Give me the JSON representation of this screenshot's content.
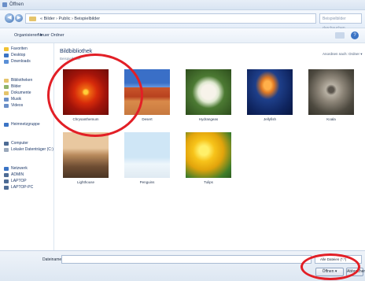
{
  "window": {
    "title": "Öffnen"
  },
  "address": {
    "path": "« Bilder › Public › Beispielbilder",
    "search_placeholder": "Beispielbilder durchsuchen"
  },
  "toolbar": {
    "organize": "Organisieren ▾",
    "new_folder": "Neuer Ordner"
  },
  "sidebar": {
    "items": [
      {
        "label": "Favoriten",
        "icon": "star-icon"
      },
      {
        "label": "Desktop",
        "icon": "desktop-icon"
      },
      {
        "label": "Downloads",
        "icon": "download-icon"
      },
      {
        "label": "Bibliotheken",
        "icon": "library-icon"
      },
      {
        "label": "Bilder",
        "icon": "pictures-icon"
      },
      {
        "label": "Dokumente",
        "icon": "documents-icon"
      },
      {
        "label": "Musik",
        "icon": "music-icon"
      },
      {
        "label": "Videos",
        "icon": "videos-icon"
      },
      {
        "label": "Heimnetzgruppe",
        "icon": "homegroup-icon"
      },
      {
        "label": "Computer",
        "icon": "computer-icon"
      },
      {
        "label": "Lokaler Datenträger (C:)",
        "icon": "drive-icon"
      },
      {
        "label": "Netzwerk",
        "icon": "network-icon"
      },
      {
        "label": "ADMIN",
        "icon": "network-pc-icon"
      },
      {
        "label": "LAPTOP",
        "icon": "network-pc-icon"
      },
      {
        "label": "LAPTOP-PC",
        "icon": "network-pc-icon"
      }
    ]
  },
  "content": {
    "title": "Bildbibliothek",
    "subtitle": "Beispielbilder",
    "arrange_label": "Anordnen nach: Ordner ▾",
    "files": [
      {
        "name": "Chrysanthemum"
      },
      {
        "name": "Desert"
      },
      {
        "name": "Hydrangeas"
      },
      {
        "name": "Jellyfish"
      },
      {
        "name": "Koala"
      },
      {
        "name": "Lighthouse"
      },
      {
        "name": "Penguins"
      },
      {
        "name": "Tulips"
      }
    ]
  },
  "footer": {
    "filename_label": "Dateiname:",
    "filename_value": "",
    "filetype": "Alle Dateien (*.*)",
    "open_label": "Öffnen",
    "cancel_label": "Abbrechen"
  },
  "colors": {
    "annotation": "#e21f26",
    "accent": "#3b74c5"
  }
}
